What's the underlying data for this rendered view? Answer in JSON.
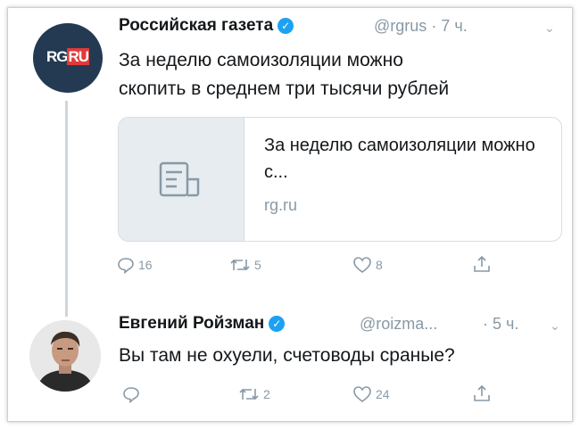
{
  "tweet1": {
    "avatar_text_rg": "RG",
    "avatar_text_ru": "RU",
    "author": "Российская газета",
    "handle": "@rgrus",
    "time": "· 7 ч.",
    "text_line1": "За неделю самоизоляции можно",
    "text_line2": "скопить в среднем три тысячи рублей",
    "card": {
      "title": "За неделю самоизоляции можно с...",
      "domain": "rg.ru"
    },
    "replies": "16",
    "retweets": "5",
    "likes": "8"
  },
  "tweet2": {
    "author": "Евгений Ройзман",
    "handle": "@roizma...",
    "time": "· 5 ч.",
    "text": "Вы там не охуели, счетоводы сраные?",
    "replies": "",
    "retweets": "2",
    "likes": "24"
  },
  "colors": {
    "verified": "#1da1f2",
    "muted": "#8899a6",
    "rg_red": "#e23a3a",
    "rg_navy": "#243a52"
  }
}
